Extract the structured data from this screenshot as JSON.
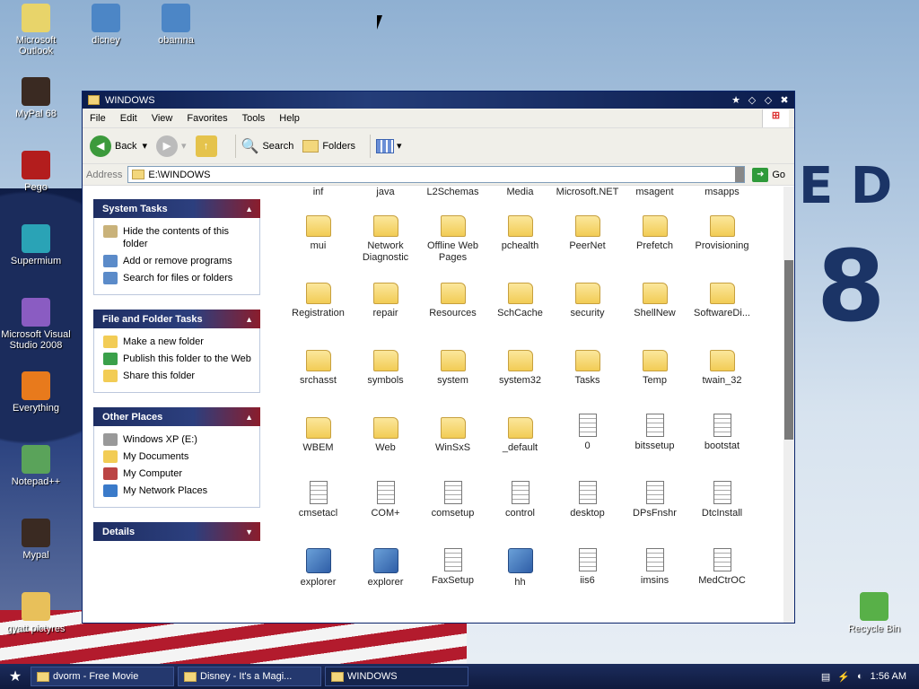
{
  "desktop": {
    "icons": [
      {
        "label": "Microsoft Outlook",
        "icon": "outlook-icon"
      },
      {
        "label": "dicney",
        "icon": "image-file-icon"
      },
      {
        "label": "obamna",
        "icon": "image-file-icon"
      },
      {
        "label": "MyPal 68",
        "icon": "mypal-icon"
      },
      {
        "label": "Pego",
        "icon": "pego-icon"
      },
      {
        "label": "Supermium",
        "icon": "supermium-icon"
      },
      {
        "label": "Microsoft Visual Studio 2008",
        "icon": "visual-studio-icon"
      },
      {
        "label": "Everything",
        "icon": "everything-icon"
      },
      {
        "label": "Notepad++",
        "icon": "notepad-plus-icon"
      },
      {
        "label": "Mypal",
        "icon": "mypal-icon"
      },
      {
        "label": "gyatt pictyres",
        "icon": "zip-folder-icon"
      },
      {
        "label": "Recycle Bin",
        "icon": "recycle-bin-icon"
      }
    ],
    "wallpaper_text": [
      "E D",
      "8"
    ]
  },
  "window": {
    "title": "WINDOWS",
    "menu": [
      "File",
      "Edit",
      "View",
      "Favorites",
      "Tools",
      "Help"
    ],
    "toolbar": {
      "back": "Back",
      "search": "Search",
      "folders": "Folders"
    },
    "address": {
      "label": "Address",
      "value": "E:\\WINDOWS",
      "go": "Go"
    }
  },
  "panels": [
    {
      "title": "System Tasks",
      "items": [
        {
          "label": "Hide the contents of this folder",
          "icon": "hide-icon"
        },
        {
          "label": "Add or remove programs",
          "icon": "add-remove-icon"
        },
        {
          "label": "Search for files or folders",
          "icon": "search-icon"
        }
      ]
    },
    {
      "title": "File and Folder Tasks",
      "items": [
        {
          "label": "Make a new folder",
          "icon": "new-folder-icon"
        },
        {
          "label": "Publish this folder to the Web",
          "icon": "publish-web-icon"
        },
        {
          "label": "Share this folder",
          "icon": "share-icon"
        }
      ]
    },
    {
      "title": "Other Places",
      "items": [
        {
          "label": "Windows XP (E:)",
          "icon": "drive-icon"
        },
        {
          "label": "My Documents",
          "icon": "my-documents-icon"
        },
        {
          "label": "My Computer",
          "icon": "my-computer-icon"
        },
        {
          "label": "My Network Places",
          "icon": "network-icon"
        }
      ]
    },
    {
      "title": "Details",
      "items": []
    }
  ],
  "files": {
    "top_row": [
      "inf",
      "java",
      "L2Schemas",
      "Media",
      "Microsoft.NET",
      "msagent",
      "msapps"
    ],
    "items": [
      {
        "name": "mui",
        "type": "folder"
      },
      {
        "name": "Network Diagnostic",
        "type": "folder"
      },
      {
        "name": "Offline Web Pages",
        "type": "special"
      },
      {
        "name": "pchealth",
        "type": "folder"
      },
      {
        "name": "PeerNet",
        "type": "folder"
      },
      {
        "name": "Prefetch",
        "type": "folder"
      },
      {
        "name": "Provisioning",
        "type": "folder"
      },
      {
        "name": "Registration",
        "type": "folder"
      },
      {
        "name": "repair",
        "type": "folder"
      },
      {
        "name": "Resources",
        "type": "folder"
      },
      {
        "name": "SchCache",
        "type": "folder"
      },
      {
        "name": "security",
        "type": "folder"
      },
      {
        "name": "ShellNew",
        "type": "folder"
      },
      {
        "name": "SoftwareDi...",
        "type": "folder"
      },
      {
        "name": "srchasst",
        "type": "folder"
      },
      {
        "name": "symbols",
        "type": "folder"
      },
      {
        "name": "system",
        "type": "folder"
      },
      {
        "name": "system32",
        "type": "folder"
      },
      {
        "name": "Tasks",
        "type": "folder"
      },
      {
        "name": "Temp",
        "type": "folder"
      },
      {
        "name": "twain_32",
        "type": "folder"
      },
      {
        "name": "WBEM",
        "type": "folder"
      },
      {
        "name": "Web",
        "type": "folder"
      },
      {
        "name": "WinSxS",
        "type": "folder"
      },
      {
        "name": "_default",
        "type": "special"
      },
      {
        "name": "0",
        "type": "doc"
      },
      {
        "name": "bitssetup",
        "type": "doc"
      },
      {
        "name": "bootstat",
        "type": "doc"
      },
      {
        "name": "cmsetacl",
        "type": "doc"
      },
      {
        "name": "COM+",
        "type": "doc"
      },
      {
        "name": "comsetup",
        "type": "doc"
      },
      {
        "name": "control",
        "type": "doc"
      },
      {
        "name": "desktop",
        "type": "doc"
      },
      {
        "name": "DPsFnshr",
        "type": "doc"
      },
      {
        "name": "DtcInstall",
        "type": "doc"
      },
      {
        "name": "explorer",
        "type": "exe"
      },
      {
        "name": "explorer",
        "type": "exe"
      },
      {
        "name": "FaxSetup",
        "type": "doc"
      },
      {
        "name": "hh",
        "type": "exe"
      },
      {
        "name": "iis6",
        "type": "doc"
      },
      {
        "name": "imsins",
        "type": "doc"
      },
      {
        "name": "MedCtrOC",
        "type": "doc"
      }
    ]
  },
  "taskbar": {
    "tasks": [
      {
        "label": "dvorm - Free Movie"
      },
      {
        "label": "Disney - It's a Magi..."
      },
      {
        "label": "WINDOWS"
      }
    ],
    "clock": "1:56 AM"
  },
  "colors": {
    "title": "#0c1d4d",
    "panel_head": "#1e2e62",
    "folder": "#f2cc55"
  }
}
